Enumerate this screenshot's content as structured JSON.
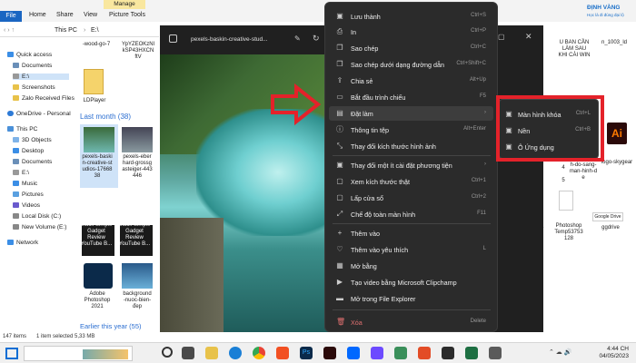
{
  "explorer": {
    "ribbon_tabs": [
      "File",
      "Home",
      "Share",
      "View",
      "Picture Tools"
    ],
    "manage_label": "Manage",
    "address": [
      "This PC",
      "E:\\"
    ],
    "nav": [
      "Quick access",
      "Documents",
      "E:\\",
      "Screenshots",
      "Zalo Received Files",
      "OneDrive - Personal",
      "This PC",
      "3D Objects",
      "Desktop",
      "Documents",
      "E:\\",
      "Music",
      "Pictures",
      "Videos",
      "Local Disk (C:)",
      "New Volume (E:)",
      "Network"
    ],
    "top_names": [
      "-wood-go-7",
      "YpYZEOKzNl\nkSP43HXCN\nftV"
    ],
    "ldplayer": "LDPlayer",
    "last_month": "Last month (38)",
    "file_caps": [
      "pexels-baski\nn-creative-st\nudios-17668\n38",
      "pexels-eber\nhard-grossg\nasteiger-443\n446",
      "Black Simple\nGadget\nReview\nYouTube B...",
      "Black Simple\nGadget\nReview\nYouTube B...",
      "Adobe\nPhotoshop\n2021",
      "background\n-nuoc-bien-\nđep"
    ],
    "earlier": "Earlier this year (55)",
    "status": {
      "items": "147 items",
      "selected": "1 item selected  5,33 MB"
    }
  },
  "right_files": {
    "top": [
      "U BAN CẦN\nLÀM SAU\nKHI CÀI WIN",
      "n_1003_ld"
    ],
    "logo1": "ĐỊNH VÀNG",
    "logo2": "Học là đi đúng đại lộ",
    "c1": "4",
    "c2": "5",
    "c3": "7-cach-chin\nh-do-sang-\nman-hinh-d\ne",
    "c4": "logo-skygear",
    "c5": "Photoshop\nTemp53753\n128",
    "c6": "ggdrive",
    "c7": "64",
    "gdrive": "Google Drive"
  },
  "viewer": {
    "title": "pexels-baskin-creative-stud..."
  },
  "menu": [
    {
      "label": "Lưu thành",
      "shortcut": "Ctrl+S",
      "icon": "save-icon",
      "glyph": "▣"
    },
    {
      "label": "In",
      "shortcut": "Ctrl+P",
      "icon": "print-icon",
      "glyph": "⎙"
    },
    {
      "label": "Sao chép",
      "shortcut": "Ctrl+C",
      "icon": "copy-icon",
      "glyph": "❐"
    },
    {
      "label": "Sao chép dưới dạng đường dẫn",
      "shortcut": "Ctrl+Shift+C",
      "icon": "copy-path-icon",
      "glyph": "❐"
    },
    {
      "label": "Chia sẻ",
      "shortcut": "Alt+Up",
      "icon": "share-icon",
      "glyph": "⇪"
    },
    {
      "label": "Bắt đầu trình chiếu",
      "shortcut": "F5",
      "icon": "slideshow-icon",
      "glyph": "▭"
    },
    {
      "label": "Đặt làm",
      "shortcut": "›",
      "icon": "set-as-icon",
      "glyph": "▤"
    },
    {
      "label": "Thông tin tệp",
      "shortcut": "Alt+Enter",
      "icon": "info-icon",
      "glyph": "ⓘ"
    },
    {
      "label": "Thay đổi kích thước hình ảnh",
      "shortcut": "",
      "icon": "resize-icon",
      "glyph": "⤡"
    },
    {
      "label": "Thay đổi một ít cài đặt phương tiện",
      "shortcut": "›",
      "icon": "media-settings-icon",
      "glyph": "▣"
    },
    {
      "label": "Xem kích thước thật",
      "shortcut": "Ctrl+1",
      "icon": "actual-size-icon",
      "glyph": "▢"
    },
    {
      "label": "Lấp cửa sổ",
      "shortcut": "Ctrl+2",
      "icon": "fill-window-icon",
      "glyph": "▢"
    },
    {
      "label": "Chế độ toàn màn hình",
      "shortcut": "F11",
      "icon": "fullscreen-icon",
      "glyph": "⤢"
    },
    {
      "label": "Thêm vào",
      "shortcut": "",
      "icon": "add-icon",
      "glyph": "+"
    },
    {
      "label": "Thêm vào yêu thích",
      "shortcut": "L",
      "icon": "favorite-icon",
      "glyph": "♡"
    },
    {
      "label": "Mở bằng",
      "shortcut": "",
      "icon": "open-with-icon",
      "glyph": "▦"
    },
    {
      "label": "Tạo video bằng Microsoft Clipchamp",
      "shortcut": "",
      "icon": "clipchamp-icon",
      "glyph": "▶"
    },
    {
      "label": "Mở trong File Explorer",
      "shortcut": "",
      "icon": "folder-icon",
      "glyph": "▬"
    },
    {
      "label": "Xóa",
      "shortcut": "Delete",
      "icon": "delete-icon",
      "glyph": "🗑"
    }
  ],
  "submenu": [
    {
      "label": "Màn hình khóa",
      "shortcut": "Ctrl+L",
      "icon": "lock-screen-icon"
    },
    {
      "label": "Nền",
      "shortcut": "Ctrl+B",
      "icon": "background-icon"
    },
    {
      "label": "Ô Ứng dụng",
      "shortcut": "",
      "icon": "app-tile-icon"
    }
  ],
  "clock": {
    "time": "4:44 CH",
    "date": "04/05/2023"
  },
  "colors": {
    "accent": "#1a66c2",
    "menu_bg": "#2b2b2b",
    "highlight": "#e4222a",
    "arrow": "#e4222a"
  }
}
